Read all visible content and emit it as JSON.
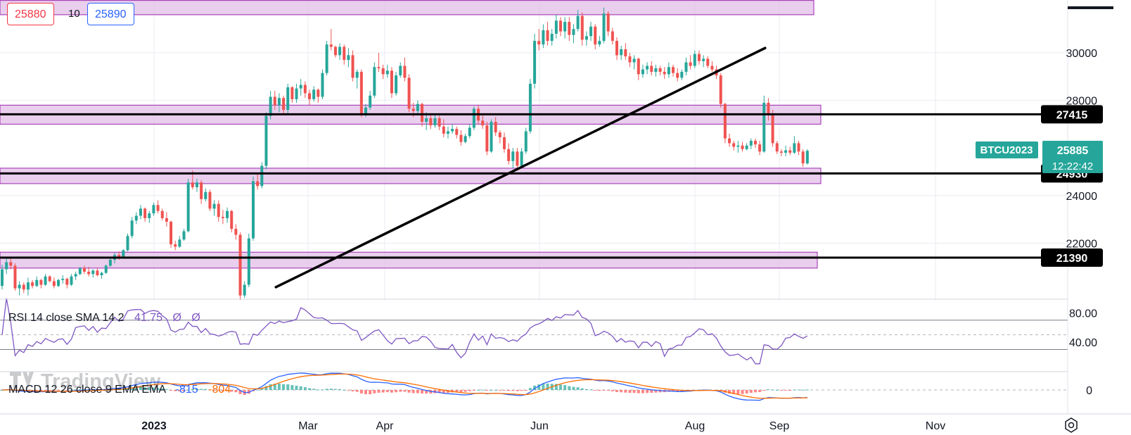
{
  "quote": {
    "sell": "25880",
    "spread": "10",
    "buy": "25890"
  },
  "watermark": "TradingView",
  "chart_data": {
    "type": "candlestick",
    "symbol": "BTCU2023",
    "last_price": "25885",
    "countdown": "12:22:42",
    "price_axis": {
      "ticks": [
        "30000",
        "28000",
        "24000",
        "22000"
      ]
    },
    "time_axis": {
      "labels": [
        "2023",
        "Mar",
        "Apr",
        "Jun",
        "Aug",
        "Sep",
        "Nov"
      ]
    },
    "horizontal_levels": [
      {
        "label": "27415",
        "value": 27415
      },
      {
        "label": "24930",
        "value": 24930
      },
      {
        "label": "21390",
        "value": 21390
      }
    ],
    "zones": [
      {
        "from": 31600,
        "to": 32200
      },
      {
        "from": 27000,
        "to": 27800
      },
      {
        "from": 24500,
        "to": 25150
      },
      {
        "from": 20950,
        "to": 21620
      }
    ],
    "trendline": {
      "from": [
        "2023-03-18",
        20150
      ],
      "to": [
        "2023-09-22",
        30200
      ]
    },
    "candles": [
      [
        20200,
        21100,
        20050,
        20900
      ],
      [
        20900,
        21350,
        20700,
        21200
      ],
      [
        21200,
        21350,
        20900,
        21050
      ],
      [
        21050,
        21150,
        20000,
        20100
      ],
      [
        20100,
        20400,
        19800,
        20250
      ],
      [
        20250,
        20350,
        19900,
        20050
      ],
      [
        20050,
        20550,
        19800,
        20350
      ],
      [
        20350,
        20450,
        20100,
        20200
      ],
      [
        20200,
        20600,
        20150,
        20450
      ],
      [
        20450,
        20500,
        20100,
        20250
      ],
      [
        20250,
        20700,
        20200,
        20600
      ],
      [
        20600,
        20650,
        20350,
        20400
      ],
      [
        20400,
        20550,
        20100,
        20200
      ],
      [
        20200,
        20500,
        20150,
        20450
      ],
      [
        20450,
        20650,
        20300,
        20500
      ],
      [
        20500,
        20550,
        20100,
        20250
      ],
      [
        20250,
        20700,
        20200,
        20600
      ],
      [
        20600,
        20800,
        20450,
        20700
      ],
      [
        20700,
        21000,
        20650,
        20950
      ],
      [
        20950,
        21050,
        20700,
        20800
      ],
      [
        20800,
        21000,
        20600,
        20700
      ],
      [
        20700,
        20900,
        20550,
        20850
      ],
      [
        20850,
        20950,
        20600,
        20650
      ],
      [
        20650,
        20800,
        20500,
        20750
      ],
      [
        20750,
        21100,
        20700,
        21050
      ],
      [
        21050,
        21350,
        21000,
        21300
      ],
      [
        21300,
        21600,
        21150,
        21500
      ],
      [
        21500,
        21650,
        21300,
        21400
      ],
      [
        21400,
        21750,
        21350,
        21700
      ],
      [
        21700,
        22400,
        21650,
        22300
      ],
      [
        22300,
        23100,
        22200,
        22950
      ],
      [
        22950,
        23300,
        22800,
        23150
      ],
      [
        23150,
        23600,
        23000,
        23450
      ],
      [
        23450,
        23500,
        22900,
        23050
      ],
      [
        23050,
        23350,
        22850,
        23250
      ],
      [
        23250,
        23700,
        23150,
        23600
      ],
      [
        23600,
        23800,
        23250,
        23350
      ],
      [
        23350,
        23450,
        22950,
        23050
      ],
      [
        23050,
        23300,
        22700,
        22900
      ],
      [
        22900,
        22950,
        21800,
        21950
      ],
      [
        21950,
        22100,
        21700,
        21850
      ],
      [
        21850,
        22300,
        21800,
        22150
      ],
      [
        22150,
        22600,
        22100,
        22500
      ],
      [
        22500,
        24700,
        22450,
        24550
      ],
      [
        24550,
        25050,
        24250,
        24350
      ],
      [
        24350,
        24700,
        24150,
        24550
      ],
      [
        24550,
        24650,
        23650,
        23850
      ],
      [
        23850,
        24300,
        23750,
        24150
      ],
      [
        24150,
        24250,
        23350,
        23450
      ],
      [
        23450,
        23800,
        23150,
        23650
      ],
      [
        23650,
        23800,
        22900,
        23100
      ],
      [
        23100,
        23400,
        22800,
        23050
      ],
      [
        23050,
        23500,
        22850,
        23350
      ],
      [
        23350,
        23400,
        22450,
        22600
      ],
      [
        22600,
        22800,
        22150,
        22350
      ],
      [
        22350,
        22450,
        19600,
        19800
      ],
      [
        19800,
        20400,
        19700,
        20250
      ],
      [
        20250,
        22400,
        20150,
        22200
      ],
      [
        22200,
        24800,
        22100,
        24600
      ],
      [
        24600,
        24900,
        24250,
        24400
      ],
      [
        24400,
        25400,
        24300,
        25250
      ],
      [
        25250,
        27500,
        25100,
        27350
      ],
      [
        27350,
        28400,
        27200,
        28150
      ],
      [
        28150,
        28400,
        27600,
        27800
      ],
      [
        27800,
        28300,
        27500,
        28100
      ],
      [
        28100,
        28200,
        27400,
        27600
      ],
      [
        27600,
        28700,
        27450,
        28550
      ],
      [
        28550,
        28600,
        27900,
        28050
      ],
      [
        28050,
        28700,
        27900,
        28500
      ],
      [
        28500,
        28900,
        28200,
        28650
      ],
      [
        28650,
        28800,
        28100,
        28300
      ],
      [
        28300,
        28450,
        27800,
        28050
      ],
      [
        28050,
        28600,
        27950,
        28450
      ],
      [
        28450,
        28500,
        27900,
        28150
      ],
      [
        28150,
        29300,
        28050,
        29150
      ],
      [
        29150,
        30500,
        29050,
        30350
      ],
      [
        30350,
        31000,
        30100,
        30250
      ],
      [
        30250,
        30300,
        29800,
        29900
      ],
      [
        29900,
        30400,
        29700,
        30250
      ],
      [
        30250,
        30350,
        29500,
        29700
      ],
      [
        29700,
        30200,
        29400,
        29900
      ],
      [
        29900,
        30100,
        28800,
        28950
      ],
      [
        28950,
        29300,
        28500,
        29200
      ],
      [
        29200,
        29300,
        27300,
        27450
      ],
      [
        27450,
        27850,
        27300,
        27700
      ],
      [
        27700,
        28400,
        27600,
        28200
      ],
      [
        28200,
        29600,
        28100,
        29400
      ],
      [
        29400,
        30000,
        29200,
        29350
      ],
      [
        29350,
        29500,
        28900,
        29100
      ],
      [
        29100,
        29500,
        28950,
        29250
      ],
      [
        29250,
        29400,
        28100,
        28300
      ],
      [
        28300,
        29200,
        28200,
        29050
      ],
      [
        29050,
        29600,
        28950,
        29450
      ],
      [
        29450,
        29800,
        28800,
        28950
      ],
      [
        28950,
        29100,
        27500,
        27650
      ],
      [
        27650,
        27900,
        27300,
        27550
      ],
      [
        27550,
        28000,
        27400,
        27850
      ],
      [
        27850,
        27900,
        26900,
        27100
      ],
      [
        27100,
        27500,
        26750,
        27250
      ],
      [
        27250,
        27450,
        26800,
        26950
      ],
      [
        26950,
        27450,
        26850,
        27250
      ],
      [
        27250,
        27350,
        26750,
        26900
      ],
      [
        26900,
        27200,
        26450,
        26600
      ],
      [
        26600,
        26900,
        26400,
        26700
      ],
      [
        26700,
        27000,
        26600,
        26800
      ],
      [
        26800,
        26900,
        26400,
        26550
      ],
      [
        26550,
        26750,
        26100,
        26250
      ],
      [
        26250,
        26600,
        26200,
        26500
      ],
      [
        26500,
        27000,
        26400,
        26850
      ],
      [
        26850,
        27750,
        26750,
        27650
      ],
      [
        27650,
        27800,
        27000,
        27150
      ],
      [
        27150,
        27400,
        26800,
        26950
      ],
      [
        26950,
        27100,
        25700,
        25850
      ],
      [
        25850,
        27200,
        25800,
        27100
      ],
      [
        27100,
        27300,
        26500,
        26650
      ],
      [
        26650,
        26750,
        26200,
        26450
      ],
      [
        26450,
        26650,
        25800,
        25950
      ],
      [
        25950,
        26200,
        25300,
        25450
      ],
      [
        25450,
        26000,
        25150,
        25850
      ],
      [
        25850,
        26000,
        25100,
        25250
      ],
      [
        25250,
        26000,
        25150,
        25850
      ],
      [
        25850,
        26850,
        25750,
        26700
      ],
      [
        26700,
        28900,
        26600,
        28700
      ],
      [
        28700,
        30800,
        28500,
        30500
      ],
      [
        30500,
        31000,
        30100,
        30350
      ],
      [
        30350,
        31200,
        30200,
        30950
      ],
      [
        30950,
        31300,
        30300,
        30500
      ],
      [
        30500,
        31000,
        30300,
        30800
      ],
      [
        30800,
        31600,
        30600,
        31350
      ],
      [
        31350,
        31500,
        30700,
        30900
      ],
      [
        30900,
        31500,
        30600,
        31300
      ],
      [
        31300,
        31500,
        30500,
        30750
      ],
      [
        30750,
        31200,
        30400,
        31000
      ],
      [
        31000,
        31800,
        30900,
        31550
      ],
      [
        31550,
        31700,
        30300,
        30550
      ],
      [
        30550,
        30900,
        30300,
        30700
      ],
      [
        30700,
        31300,
        30500,
        31100
      ],
      [
        31100,
        31200,
        30150,
        30350
      ],
      [
        30350,
        30700,
        30250,
        30500
      ],
      [
        30500,
        31900,
        30400,
        31650
      ],
      [
        31650,
        31750,
        30700,
        30900
      ],
      [
        30900,
        31050,
        30350,
        30500
      ],
      [
        30500,
        30650,
        29700,
        29900
      ],
      [
        29900,
        30300,
        29700,
        30150
      ],
      [
        30150,
        30400,
        29700,
        29850
      ],
      [
        29850,
        30000,
        29400,
        29600
      ],
      [
        29600,
        29900,
        29300,
        29750
      ],
      [
        29750,
        29800,
        28850,
        29100
      ],
      [
        29100,
        29500,
        28950,
        29300
      ],
      [
        29300,
        29600,
        29100,
        29450
      ],
      [
        29450,
        29650,
        29050,
        29200
      ],
      [
        29200,
        29500,
        29000,
        29350
      ],
      [
        29350,
        29450,
        29050,
        29200
      ],
      [
        29200,
        29400,
        28900,
        29100
      ],
      [
        29100,
        29600,
        28950,
        29400
      ],
      [
        29400,
        29500,
        29000,
        29150
      ],
      [
        29150,
        29350,
        28800,
        28950
      ],
      [
        28950,
        29300,
        28850,
        29200
      ],
      [
        29200,
        29800,
        29050,
        29600
      ],
      [
        29600,
        29900,
        29300,
        29450
      ],
      [
        29450,
        30100,
        29350,
        29950
      ],
      [
        29950,
        30100,
        29500,
        29650
      ],
      [
        29650,
        29900,
        29400,
        29750
      ],
      [
        29750,
        29850,
        29350,
        29450
      ],
      [
        29450,
        29650,
        29200,
        29300
      ],
      [
        29300,
        29450,
        28900,
        29050
      ],
      [
        29050,
        29150,
        27700,
        27850
      ],
      [
        27850,
        27900,
        26200,
        26400
      ],
      [
        26400,
        26600,
        26050,
        26200
      ],
      [
        26200,
        26300,
        25900,
        26050
      ],
      [
        26050,
        26300,
        25800,
        26100
      ],
      [
        26100,
        26250,
        25850,
        25950
      ],
      [
        25950,
        26200,
        25900,
        26100
      ],
      [
        26100,
        26400,
        25950,
        26300
      ],
      [
        26300,
        26400,
        26000,
        26150
      ],
      [
        26150,
        26300,
        25700,
        25850
      ],
      [
        25850,
        28200,
        25800,
        27900
      ],
      [
        27900,
        28100,
        27150,
        27450
      ],
      [
        27450,
        27600,
        26050,
        26200
      ],
      [
        26200,
        26300,
        25750,
        25850
      ],
      [
        25850,
        25950,
        25650,
        25800
      ],
      [
        25800,
        26100,
        25650,
        25900
      ],
      [
        25900,
        26050,
        25700,
        25800
      ],
      [
        25800,
        26500,
        25750,
        26200
      ],
      [
        26200,
        26300,
        25700,
        25850
      ],
      [
        25850,
        25950,
        25200,
        25350
      ],
      [
        25350,
        25950,
        25300,
        25880
      ]
    ]
  },
  "rsi": {
    "label": "RSI 14 close SMA 14 2",
    "value": "41.75",
    "extra1": "Ø",
    "extra2": "Ø",
    "axis": [
      "80.00",
      "40.00"
    ],
    "levels": [
      70,
      50,
      30
    ],
    "range": [
      17,
      92
    ]
  },
  "macd": {
    "label": "MACD 12 26 close 9 EMA EMA",
    "value1": "-815",
    "value2": "-804",
    "axis": [
      "0"
    ]
  },
  "colors": {
    "up": "#26a69a",
    "down": "#ef5350",
    "zone_fill": "#e1bee7",
    "zone_stroke": "#9c27b0",
    "level_line": "#000000",
    "trendline": "#000000",
    "rsi_line": "#7e57c2",
    "macd_line": "#2962ff",
    "signal_line": "#ff6d00",
    "symbol_badge": "#26a69a",
    "price_label_bg": "#000000"
  }
}
